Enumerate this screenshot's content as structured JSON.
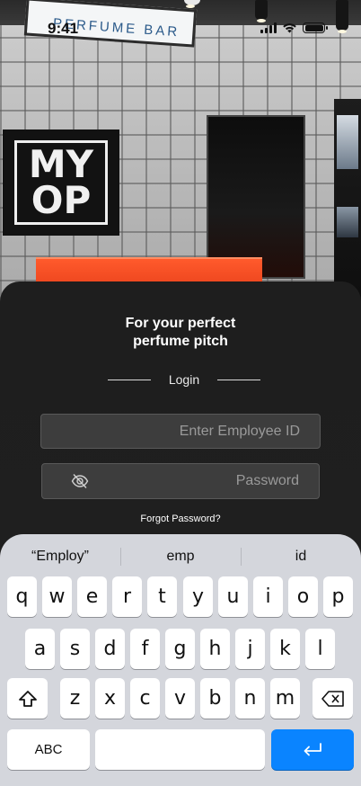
{
  "status_bar": {
    "time": "9:41"
  },
  "background": {
    "store_sign": "PERFUME BAR",
    "logo_line1": "MY",
    "logo_line2": "OP"
  },
  "login": {
    "headline_line1": "For your perfect",
    "headline_line2": "perfume pitch",
    "section_label": "Login",
    "employee_id_placeholder": "Enter Employee ID",
    "employee_id_value": "",
    "password_placeholder": "Password",
    "password_value": "",
    "forgot_password": "Forgot Password?"
  },
  "keyboard": {
    "suggestions": [
      "“Employ”",
      "emp",
      "id"
    ],
    "row1": [
      "q",
      "w",
      "e",
      "r",
      "t",
      "y",
      "u",
      "i",
      "o",
      "p"
    ],
    "row2": [
      "a",
      "s",
      "d",
      "f",
      "g",
      "h",
      "j",
      "k",
      "l"
    ],
    "row3": [
      "z",
      "x",
      "c",
      "v",
      "b",
      "n",
      "m"
    ],
    "abc_label": "ABC",
    "return_color": "#0a84ff"
  },
  "colors": {
    "sheet_bg": "#1e1e1e",
    "field_bg": "#3d3d3d",
    "keyboard_bg": "#d4d6dc",
    "counter": "#ff5a2c"
  }
}
